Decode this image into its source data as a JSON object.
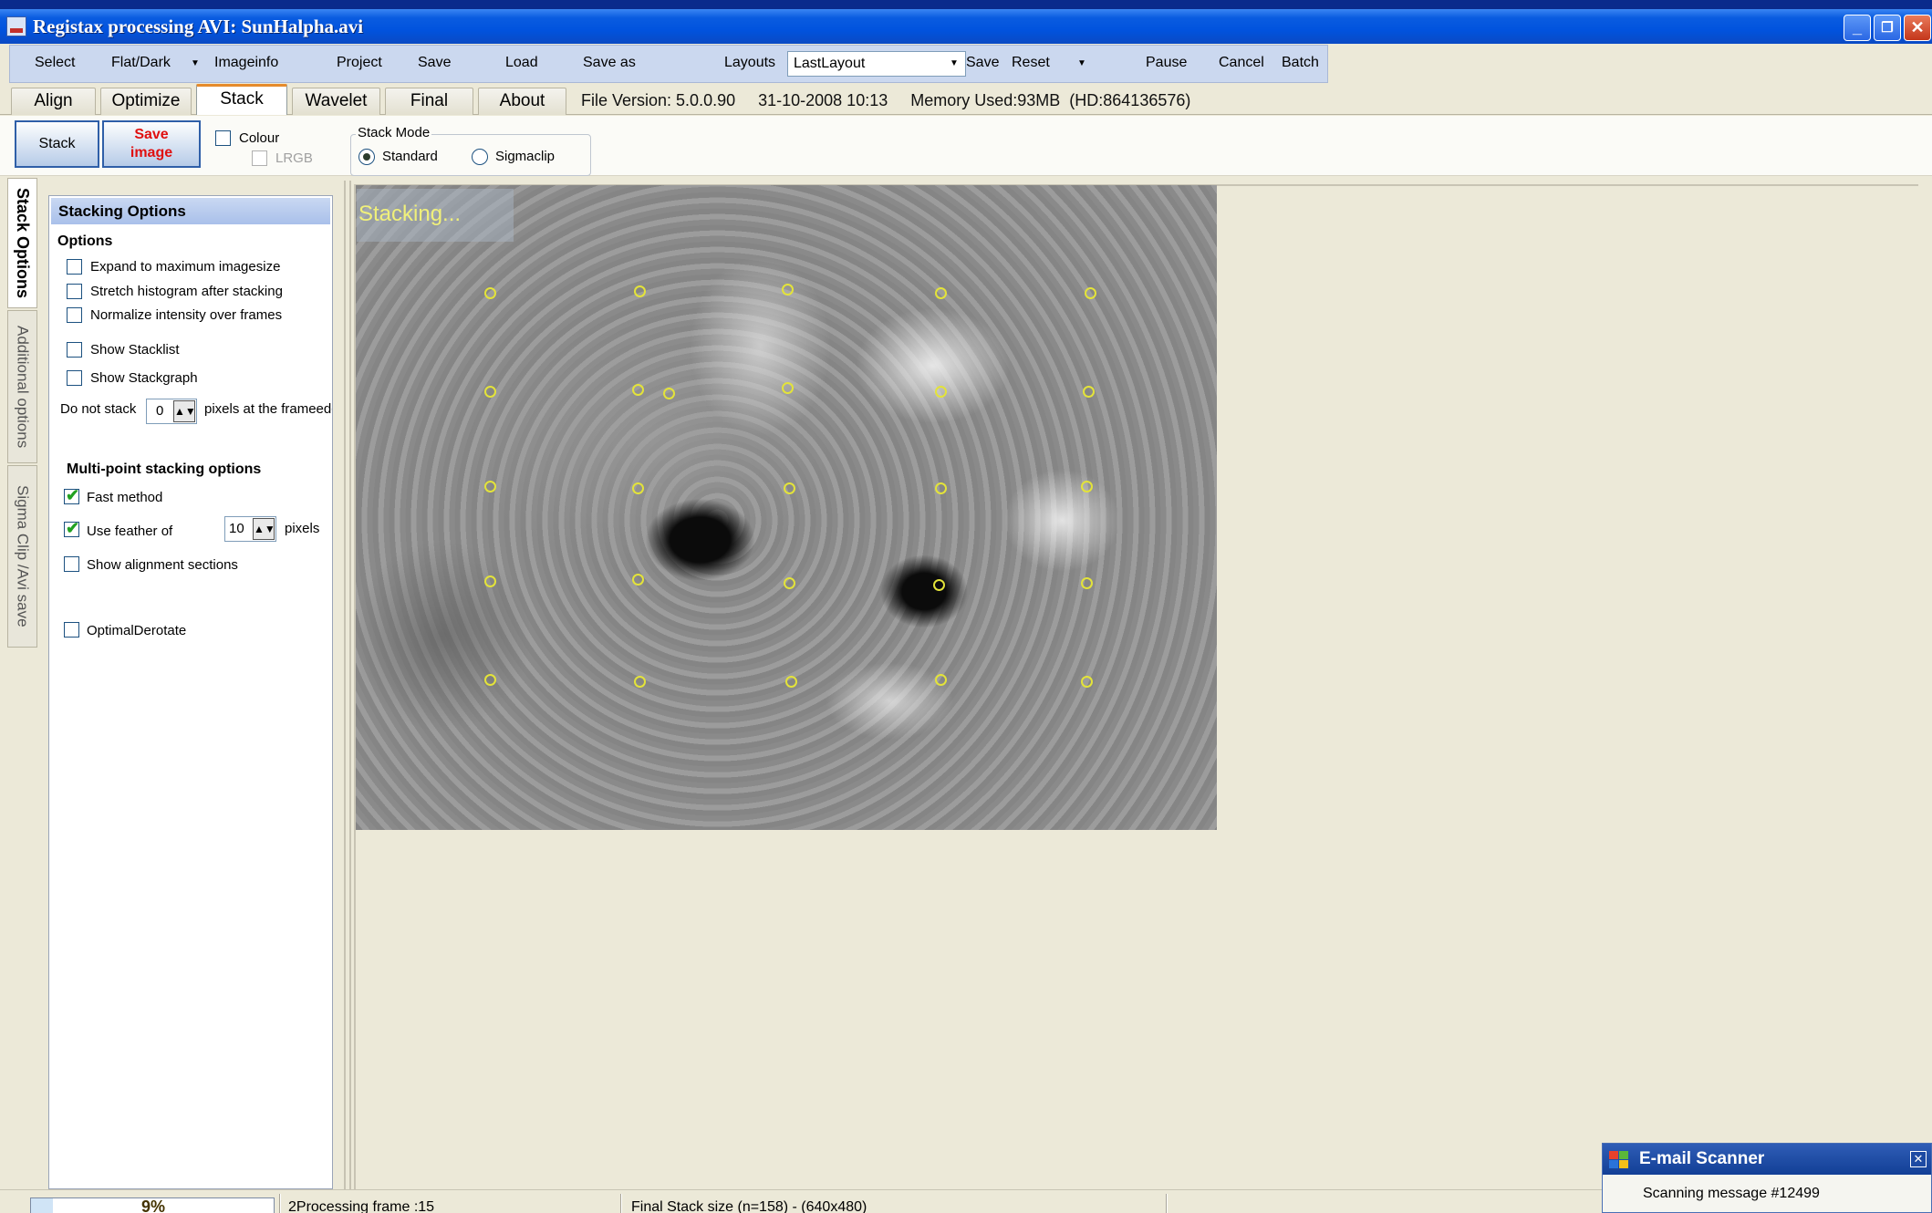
{
  "window": {
    "title": "Registax processing AVI: SunHalpha.avi",
    "controls": {
      "minimize": "_",
      "restore": "❐",
      "close": "✕"
    }
  },
  "menu": {
    "select": "Select",
    "flatdark": "Flat/Dark",
    "imageinfo": "Imageinfo",
    "project": "Project",
    "save": "Save",
    "load": "Load",
    "save_as": "Save as",
    "layouts_label": "Layouts",
    "layout_value": "LastLayout",
    "layout_save": "Save",
    "reset": "Reset",
    "pause": "Pause",
    "cancel": "Cancel",
    "batch": "Batch"
  },
  "tabs": [
    {
      "label": "Align"
    },
    {
      "label": "Optimize"
    },
    {
      "label": "Stack",
      "active": true
    },
    {
      "label": "Wavelet"
    },
    {
      "label": "Final"
    },
    {
      "label": "About"
    }
  ],
  "fileinfo": "File Version: 5.0.0.90     31-10-2008 10:13     Memory Used:93MB  (HD:864136576)",
  "toolbar": {
    "stack_label": "Stack",
    "save_image_line1": "Save",
    "save_image_line2": "image",
    "colour_label": "Colour",
    "colour_checked": false,
    "lrgb_label": "LRGB",
    "lrgb_checked": false,
    "stack_mode": {
      "label": "Stack Mode",
      "standard": "Standard",
      "sigmaclip": "Sigmaclip",
      "selected": "Standard"
    }
  },
  "side_tabs": {
    "stack_options": "Stack Options",
    "additional_options": "Additional options",
    "sigma_clip": "Sigma Clip /Avi save"
  },
  "panel": {
    "title": "Stacking Options",
    "options_header": "Options",
    "expand": "Expand to maximum imagesize",
    "stretch": "Stretch histogram after stacking",
    "normalize": "Normalize intensity over frames",
    "show_stacklist": "Show Stacklist",
    "show_stackgraph": "Show Stackgraph",
    "do_not_stack": "Do not stack",
    "do_not_stack_value": "0",
    "pixels_at_frame": "pixels at the frameedge",
    "multi_header": "Multi-point stacking options",
    "fast_method": "Fast method",
    "fast_method_checked": true,
    "use_feather": "Use feather of",
    "use_feather_checked": true,
    "feather_value": "10",
    "pixels": "pixels",
    "show_alignment": "Show alignment sections",
    "optimal_derotate": "OptimalDerotate"
  },
  "viewer": {
    "overlay_text": "Stacking..."
  },
  "status": {
    "progress_percent": 9,
    "progress_text": "9%",
    "processing": "2Processing frame :15",
    "final_stack": "Final Stack size (n=158) - (640x480)"
  },
  "email_popup": {
    "title": "E-mail Scanner",
    "message": "Scanning message #12499",
    "close": "✕"
  },
  "colors": {
    "titlebar": "#0153de",
    "accent_tab": "#e68b2c",
    "alignpoint": "#e3e33a",
    "save_image_text": "#e01010"
  }
}
